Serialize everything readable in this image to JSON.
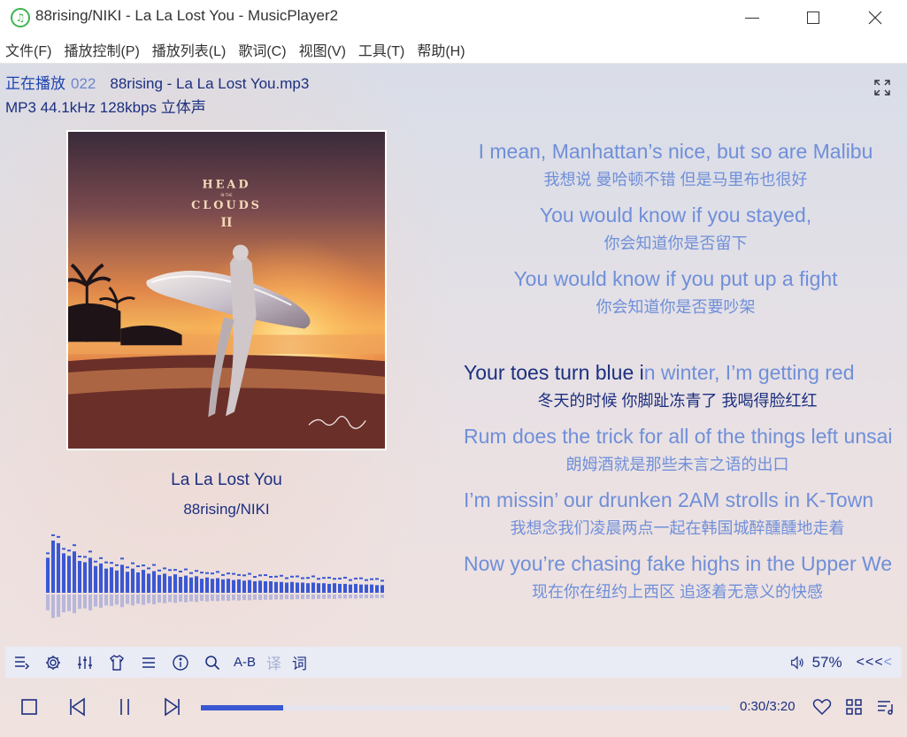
{
  "window": {
    "title": "88rising/NIKI - La La Lost You - MusicPlayer2"
  },
  "menu": [
    "文件(F)",
    "播放控制(P)",
    "播放列表(L)",
    "歌词(C)",
    "视图(V)",
    "工具(T)",
    "帮助(H)"
  ],
  "now_playing": {
    "label": "正在播放",
    "index": "022",
    "file": "88rising - La La Lost You.mp3",
    "format": "MP3 44.1kHz 128kbps 立体声"
  },
  "album_cover": {
    "title_line1": "HEAD",
    "title_small": "IN THE",
    "title_line2": "CLOUDS",
    "title_line3": "II"
  },
  "song": {
    "title": "La La Lost You",
    "artist": "88rising/NIKI"
  },
  "spectrum": {
    "levels": [
      0.55,
      0.82,
      0.78,
      0.62,
      0.58,
      0.65,
      0.5,
      0.48,
      0.55,
      0.42,
      0.46,
      0.38,
      0.4,
      0.35,
      0.44,
      0.33,
      0.38,
      0.32,
      0.36,
      0.3,
      0.34,
      0.28,
      0.3,
      0.26,
      0.29,
      0.25,
      0.27,
      0.24,
      0.26,
      0.22,
      0.24,
      0.22,
      0.23,
      0.21,
      0.22,
      0.2,
      0.21,
      0.19,
      0.2,
      0.18,
      0.19,
      0.18,
      0.18,
      0.17,
      0.17,
      0.16,
      0.17,
      0.16,
      0.16,
      0.15,
      0.16,
      0.15,
      0.15,
      0.14,
      0.15,
      0.14,
      0.14,
      0.13,
      0.14,
      0.13,
      0.13,
      0.13,
      0.12,
      0.12
    ],
    "bar_color": "#3a58d4"
  },
  "lyrics": [
    {
      "en": "I mean, Manhattan’s nice, but so are Malibu",
      "cn": "我想说 曼哈顿不错 但是马里布也很好",
      "current": false
    },
    {
      "en": "You would know if you stayed,",
      "cn": "你会知道你是否留下",
      "current": false
    },
    {
      "en": "You would know if you put up a fight",
      "cn": "你会知道你是否要吵架",
      "current": false
    },
    {
      "en_sung": "Your toes turn blue i",
      "en_rest": "n winter, I’m getting red",
      "cn": "冬天的时候 你脚趾冻青了 我喝得脸红红",
      "current": true
    },
    {
      "en": "Rum does the trick for all of the things left unsaid",
      "cn": "朗姆酒就是那些未言之语的出口",
      "current": false
    },
    {
      "en": "I’m missin’ our drunken 2AM strolls in K-Town",
      "cn": "我想念我们凌晨两点一起在韩国城醉醺醺地走着",
      "current": false
    },
    {
      "en": "Now you’re chasing fake highs in the Upper West Side",
      "cn": "现在你在纽约上西区 追逐着无意义的快感",
      "current": false
    }
  ],
  "toolbar": {
    "ab_label": "A-B",
    "translate_label": "译",
    "lyrics_label": "词",
    "volume": "57%",
    "arrows_dark": "<<<",
    "arrows_light": "<"
  },
  "playback": {
    "time": "0:30/3:20",
    "progress": 0.155,
    "accent": "#3a58d4"
  }
}
